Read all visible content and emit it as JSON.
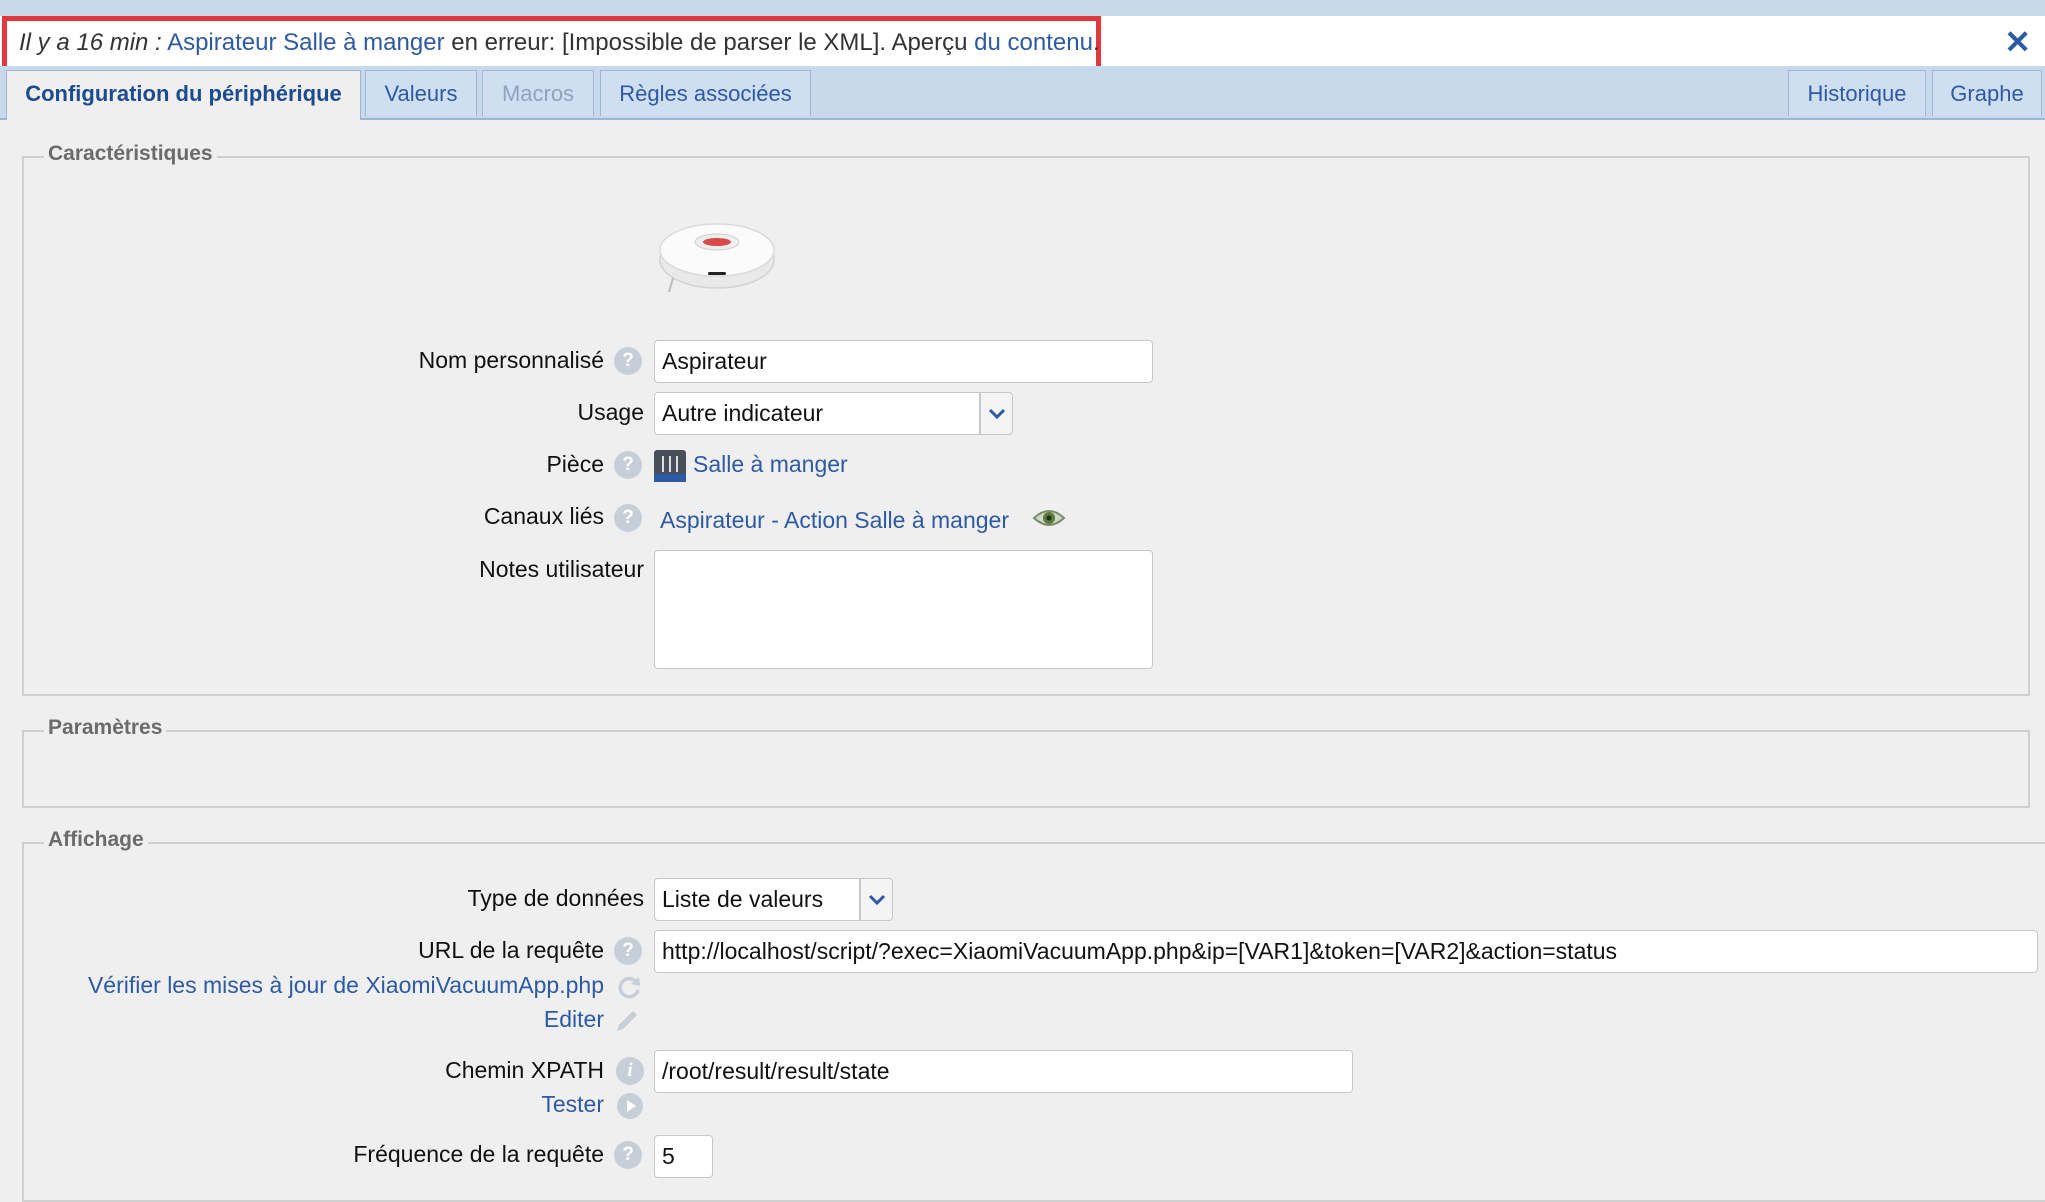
{
  "error_bar": {
    "time": "Il y a 16 min :",
    "device_link": "Aspirateur Salle à manger",
    "message": "en erreur: [Impossible de parser le XML]. Aperçu",
    "content_link": "du contenu",
    "period": ".",
    "close": "✕"
  },
  "tabs": [
    {
      "label": "Configuration du périphérique",
      "state": "active"
    },
    {
      "label": "Valeurs",
      "state": "normal"
    },
    {
      "label": "Macros",
      "state": "disabled"
    },
    {
      "label": "Règles associées",
      "state": "normal"
    },
    {
      "label": "Historique",
      "state": "normal"
    },
    {
      "label": "Graphe",
      "state": "normal"
    }
  ],
  "characteristics": {
    "legend": "Caractéristiques",
    "device_icon": "robot-vacuum-icon",
    "name_label": "Nom personnalisé",
    "name_value": "Aspirateur",
    "usage_label": "Usage",
    "usage_value": "Autre indicateur",
    "room_label": "Pièce",
    "room_icon": "dining-room-icon",
    "room_value": "Salle à manger",
    "channels_label": "Canaux liés",
    "channels_value": "Aspirateur - Action Salle à manger",
    "notes_label": "Notes utilisateur",
    "notes_value": ""
  },
  "parameters": {
    "legend": "Paramètres"
  },
  "display": {
    "legend": "Affichage",
    "data_type_label": "Type de données",
    "data_type_value": "Liste de valeurs",
    "url_label": "URL de la requête",
    "url_value": "http://localhost/script/?exec=XiaomiVacuumApp.php&ip=[VAR1]&token=[VAR2]&action=status",
    "check_updates_link": "Vérifier les mises à jour de XiaomiVacuumApp.php",
    "edit_link": "Editer",
    "xpath_label": "Chemin XPATH",
    "xpath_value": "/root/result/result/state",
    "test_link": "Tester",
    "frequency_label": "Fréquence de la requête",
    "frequency_value": "5"
  },
  "help_glyph": "?",
  "info_glyph": "i"
}
